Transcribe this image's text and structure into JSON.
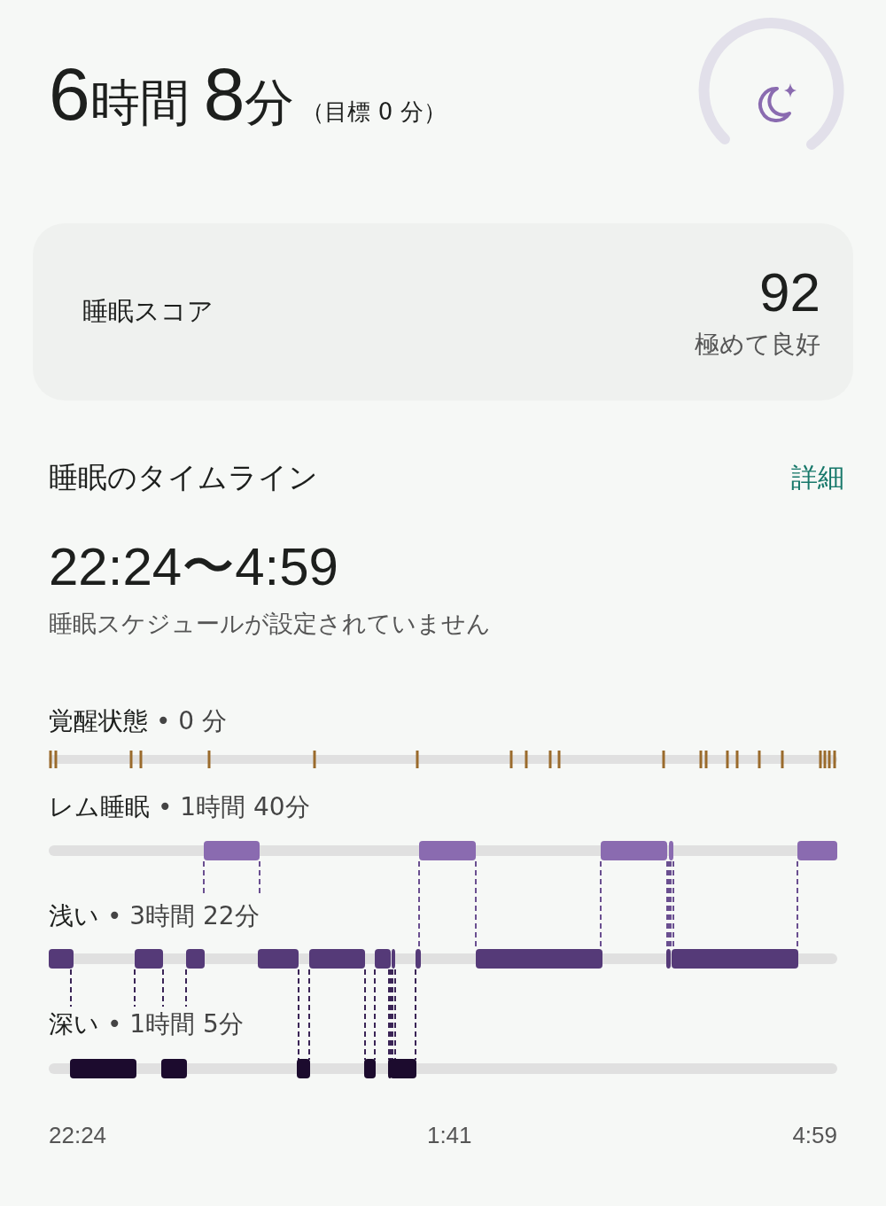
{
  "header": {
    "hours": "6",
    "hours_unit": "時間",
    "minutes": "8",
    "minutes_unit": "分",
    "goal": "（目標 0 分）"
  },
  "score_card": {
    "label": "睡眠スコア",
    "score": "92",
    "rating": "極めて良好"
  },
  "timeline": {
    "title": "睡眠のタイムライン",
    "details_link": "詳細",
    "range": "22:24〜4:59",
    "note": "睡眠スケジュールが設定されていません",
    "stages": [
      {
        "kind": "awake",
        "name": "覚醒状態",
        "duration": "• 0 分"
      },
      {
        "kind": "rem",
        "name": "レム睡眠",
        "duration": "• 1時間 40分"
      },
      {
        "kind": "light",
        "name": "浅い",
        "duration": "• 3時間 22分"
      },
      {
        "kind": "deep",
        "name": "深い",
        "duration": "• 1時間 5分"
      }
    ],
    "axis_labels": [
      "22:24",
      "1:41",
      "4:59"
    ]
  }
}
